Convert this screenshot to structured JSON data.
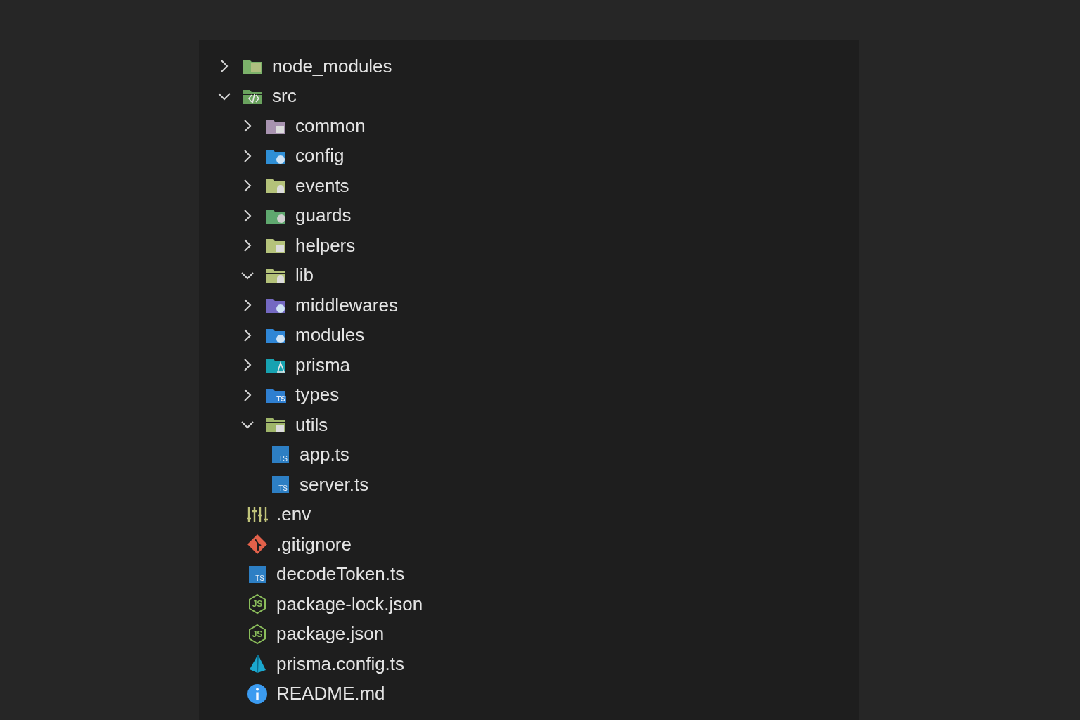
{
  "explorer": {
    "items": [
      {
        "kind": "folder",
        "color": "#7cb26a",
        "label": "node_modules",
        "expanded": false
      },
      {
        "kind": "folder",
        "color": "#6aa35e",
        "label": "src",
        "expanded": true,
        "children": [
          {
            "kind": "folder",
            "color": "#a893b0",
            "label": "common",
            "expanded": false
          },
          {
            "kind": "folder",
            "color": "#2f8fd6",
            "label": "config",
            "expanded": false
          },
          {
            "kind": "folder",
            "color": "#b4c27a",
            "label": "events",
            "expanded": false
          },
          {
            "kind": "folder",
            "color": "#5fa86f",
            "label": "guards",
            "expanded": false
          },
          {
            "kind": "folder",
            "color": "#b5c37b",
            "label": "helpers",
            "expanded": false
          },
          {
            "kind": "folder",
            "color": "#b3c179",
            "label": "lib",
            "expanded": true
          },
          {
            "kind": "folder",
            "color": "#7469c2",
            "label": "middlewares",
            "expanded": false
          },
          {
            "kind": "folder",
            "color": "#2f86d6",
            "label": "modules",
            "expanded": false
          },
          {
            "kind": "folder",
            "color": "#17a2b1",
            "label": "prisma",
            "expanded": false
          },
          {
            "kind": "folder",
            "color": "#2f7fd0",
            "label": "types",
            "expanded": false,
            "badge": "TS"
          },
          {
            "kind": "folder",
            "color": "#9fb56a",
            "label": "utils",
            "expanded": true
          },
          {
            "kind": "ts",
            "label": "app.ts",
            "badge": "TS"
          },
          {
            "kind": "ts",
            "label": "server.ts",
            "badge": "TS"
          }
        ]
      },
      {
        "kind": "env",
        "label": ".env"
      },
      {
        "kind": "git",
        "label": ".gitignore"
      },
      {
        "kind": "ts",
        "label": "decodeToken.ts",
        "badge": "TS"
      },
      {
        "kind": "json",
        "label": "package-lock.json",
        "badge": "JS"
      },
      {
        "kind": "json",
        "label": "package.json",
        "badge": "JS"
      },
      {
        "kind": "prisma",
        "label": "prisma.config.ts"
      },
      {
        "kind": "readme",
        "label": "README.md"
      }
    ]
  }
}
